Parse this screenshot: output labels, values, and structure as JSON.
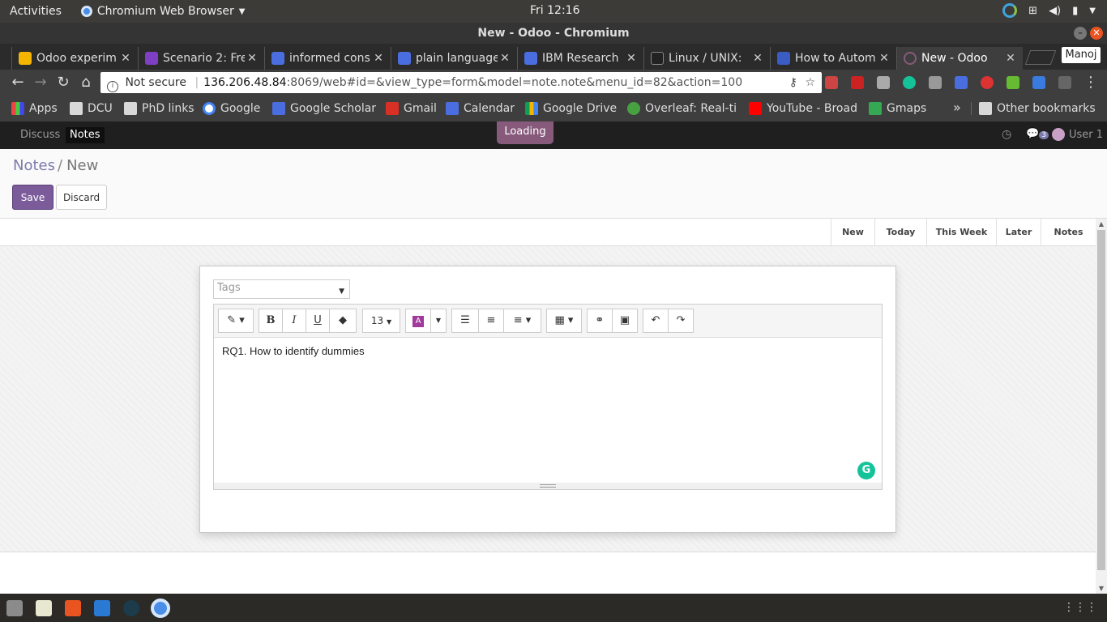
{
  "system": {
    "activities": "Activities",
    "app_name": "Chromium Web Browser",
    "clock": "Fri 12:16"
  },
  "window": {
    "title": "New - Odoo - Chromium"
  },
  "tabs": [
    {
      "label": "Odoo experim",
      "color": "#f4b400"
    },
    {
      "label": "Scenario 2: Fre",
      "color": "#7e3fc4"
    },
    {
      "label": "informed cons",
      "color": "#4a6ee0"
    },
    {
      "label": "plain language",
      "color": "#4a6ee0"
    },
    {
      "label": "IBM Research",
      "color": "#4a6ee0"
    },
    {
      "label": "Linux / UNIX:",
      "color": "#222222"
    },
    {
      "label": "How to Autom",
      "color": "#3b5cc4"
    },
    {
      "label": "New - Odoo",
      "color": "#875a7b",
      "active": true
    }
  ],
  "profile": "Manoj",
  "address": {
    "security": "Not secure",
    "host": "136.206.48.84",
    "path": ":8069/web#id=&view_type=form&model=note.note&menu_id=82&action=100"
  },
  "bookmarks": [
    {
      "label": "Apps",
      "color": "#e05050"
    },
    {
      "label": "DCU",
      "color": "#d8d8d8"
    },
    {
      "label": "PhD links",
      "color": "#d8d8d8"
    },
    {
      "label": "Google",
      "color": "#4285f4"
    },
    {
      "label": "Google Scholar",
      "color": "#4a6ee0"
    },
    {
      "label": "Gmail",
      "color": "#d93025"
    },
    {
      "label": "Calendar",
      "color": "#4a6ee0"
    },
    {
      "label": "Google Drive",
      "color": "#0f9d58"
    },
    {
      "label": "Overleaf: Real-ti",
      "color": "#47a141"
    },
    {
      "label": "YouTube - Broad",
      "color": "#ff0000"
    },
    {
      "label": "Gmaps",
      "color": "#34a853"
    }
  ],
  "bookmarks_more": "»",
  "other_bookmarks": "Other bookmarks",
  "odoo": {
    "menu": [
      "Discuss",
      "Notes"
    ],
    "loading": "Loading",
    "message_count": "3",
    "user": "User 1"
  },
  "breadcrumb": {
    "parent": "Notes",
    "separator": "/",
    "current": "New"
  },
  "buttons": {
    "save": "Save",
    "discard": "Discard"
  },
  "stages": [
    "New",
    "Today",
    "This Week",
    "Later",
    "Notes"
  ],
  "form": {
    "tags_placeholder": "Tags",
    "font_size": "13",
    "content": "RQ1. How to identify dummies"
  },
  "colors": {
    "odoo_primary": "#7c5b9b",
    "odoo_loading": "#875a7b"
  }
}
